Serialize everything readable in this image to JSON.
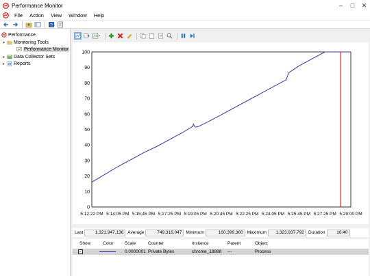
{
  "window": {
    "title": "Performance Monitor"
  },
  "menu": [
    "File",
    "Action",
    "View",
    "Window",
    "Help"
  ],
  "tree": {
    "root": "Performance",
    "monitoring_tools": "Monitoring Tools",
    "performance_monitor": "Performance Monitor",
    "data_collector_sets": "Data Collector Sets",
    "reports": "Reports"
  },
  "chart_data": {
    "type": "line",
    "title": "",
    "xlabel": "",
    "ylabel": "",
    "ylim": [
      0,
      100
    ],
    "yticks": [
      0,
      10,
      20,
      30,
      40,
      50,
      60,
      70,
      80,
      90,
      100
    ],
    "xticks": [
      "5:12:22 PM",
      "5:14:05 PM",
      "5:15:45 PM",
      "5:17:25 PM",
      "5:19:05 PM",
      "5:20:45 PM",
      "5:22:25 PM",
      "5:24:05 PM",
      "5:25:45 PM",
      "5:27:25 PM",
      "5:29:00 PM"
    ],
    "grid": false,
    "series": [
      {
        "name": "Private Bytes",
        "color": "#3333aa",
        "x": [
          0,
          0.5,
          1,
          1.5,
          2,
          2.5,
          3,
          3.5,
          3.9,
          3.92,
          3.97,
          4.0,
          4.1,
          4.5,
          5,
          5.5,
          6,
          6.5,
          7,
          7.5,
          7.6,
          8,
          8.5,
          9,
          9.5,
          10
        ],
        "values": [
          16,
          21,
          26,
          30.5,
          35,
          39,
          43.5,
          48,
          52,
          53.5,
          52,
          51.5,
          51.8,
          55,
          59.5,
          64,
          68.5,
          73,
          77.5,
          82,
          86.5,
          91,
          95.5,
          100,
          100,
          100
        ]
      }
    ],
    "current_time_x": 9.6
  },
  "stats": {
    "last_label": "Last",
    "last_value": "1,321,947,136",
    "average_label": "Average",
    "average_value": "749,316,047",
    "minimum_label": "Minimum",
    "minimum_value": "160,399,360",
    "maximum_label": "Maximum",
    "maximum_value": "1,323,937,792",
    "duration_label": "Duration",
    "duration_value": "16:40"
  },
  "counters": {
    "headers": {
      "show": "Show",
      "color": "Color",
      "scale": "Scale",
      "counter": "Counter",
      "instance": "Instance",
      "parent": "Parent",
      "object": "Object"
    },
    "rows": [
      {
        "show": "✓",
        "scale": "0.0000001",
        "counter": "Private Bytes",
        "instance": "chrome_18888",
        "parent": "---",
        "object": "Process"
      }
    ]
  }
}
